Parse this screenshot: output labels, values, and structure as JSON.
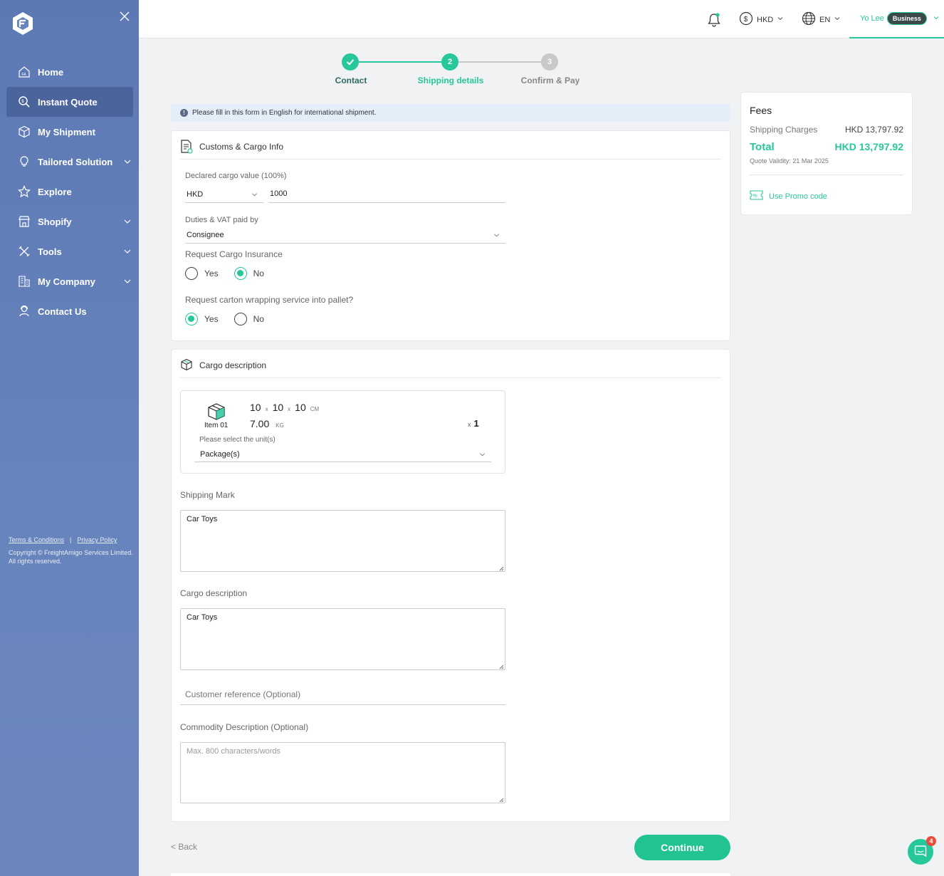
{
  "sidebar": {
    "items": [
      {
        "label": "Home",
        "icon": "home-icon",
        "active": false,
        "expandable": false
      },
      {
        "label": "Instant Quote",
        "icon": "instant-quote-icon",
        "active": true,
        "expandable": false
      },
      {
        "label": "My Shipment",
        "icon": "box-icon",
        "active": false,
        "expandable": false
      },
      {
        "label": "Tailored Solution",
        "icon": "lightbulb-icon",
        "active": false,
        "expandable": true
      },
      {
        "label": "Explore",
        "icon": "star-icon",
        "active": false,
        "expandable": false
      },
      {
        "label": "Shopify",
        "icon": "store-icon",
        "active": false,
        "expandable": true
      },
      {
        "label": "Tools",
        "icon": "tools-icon",
        "active": false,
        "expandable": true
      },
      {
        "label": "My Company",
        "icon": "building-icon",
        "active": false,
        "expandable": true
      },
      {
        "label": "Contact Us",
        "icon": "support-agent-icon",
        "active": false,
        "expandable": false
      }
    ],
    "footer": {
      "terms": "Terms & Conditions",
      "separator": "|",
      "privacy": "Privacy Policy",
      "copyright": "Copyright © FreightAmigo Services Limited. All rights reserved."
    }
  },
  "topbar": {
    "currency": "HKD",
    "language": "EN",
    "user_name": "Yo Lee",
    "user_badge": "Business"
  },
  "stepper": {
    "steps": [
      {
        "label": "Contact",
        "number": "1",
        "state": "done"
      },
      {
        "label": "Shipping details",
        "number": "2",
        "state": "current"
      },
      {
        "label": "Confirm & Pay",
        "number": "3",
        "state": "pending"
      }
    ]
  },
  "notice": "Please fill in this form in English for international shipment.",
  "customs": {
    "title": "Customs & Cargo Info",
    "declared_label": "Declared cargo value (100%)",
    "declared_currency": "HKD",
    "declared_value": "1000",
    "duties_label": "Duties & VAT paid by",
    "duties_value": "Consignee",
    "insurance_label": "Request Cargo Insurance",
    "insurance_options": [
      "Yes",
      "No"
    ],
    "insurance_selected": "No",
    "wrapping_label": "Request carton wrapping service into pallet?",
    "wrapping_options": [
      "Yes",
      "No"
    ],
    "wrapping_selected": "Yes"
  },
  "cargo": {
    "title": "Cargo description",
    "item": {
      "name": "Item 01",
      "length": "10",
      "width": "10",
      "height": "10",
      "times": "x",
      "dim_unit": "CM",
      "weight": "7.00",
      "weight_unit": "KG",
      "qty_prefix": "x",
      "quantity": "1",
      "unit_label": "Please select the unit(s)",
      "unit_value": "Package(s)"
    },
    "shipping_mark_label": "Shipping Mark",
    "shipping_mark_value": "Car Toys",
    "description_label": "Cargo description",
    "description_value": "Car Toys",
    "customer_ref_placeholder": "Customer reference (Optional)",
    "commodity_label": "Commodity Description (Optional)",
    "commodity_placeholder": "Max. 800 characters/words"
  },
  "fees": {
    "title": "Fees",
    "shipping_label": "Shipping Charges",
    "shipping_value": "HKD 13,797.92",
    "total_label": "Total",
    "total_value": "HKD 13,797.92",
    "validity": "Quote Validity: 21 Mar 2025",
    "promo": "Use Promo code"
  },
  "actions": {
    "back": "< Back",
    "continue": "Continue"
  },
  "chat": {
    "unread": "4"
  },
  "colors": {
    "accent": "#26c79b",
    "sidebar": "#6884bc",
    "pending": "#c8c8c8"
  }
}
